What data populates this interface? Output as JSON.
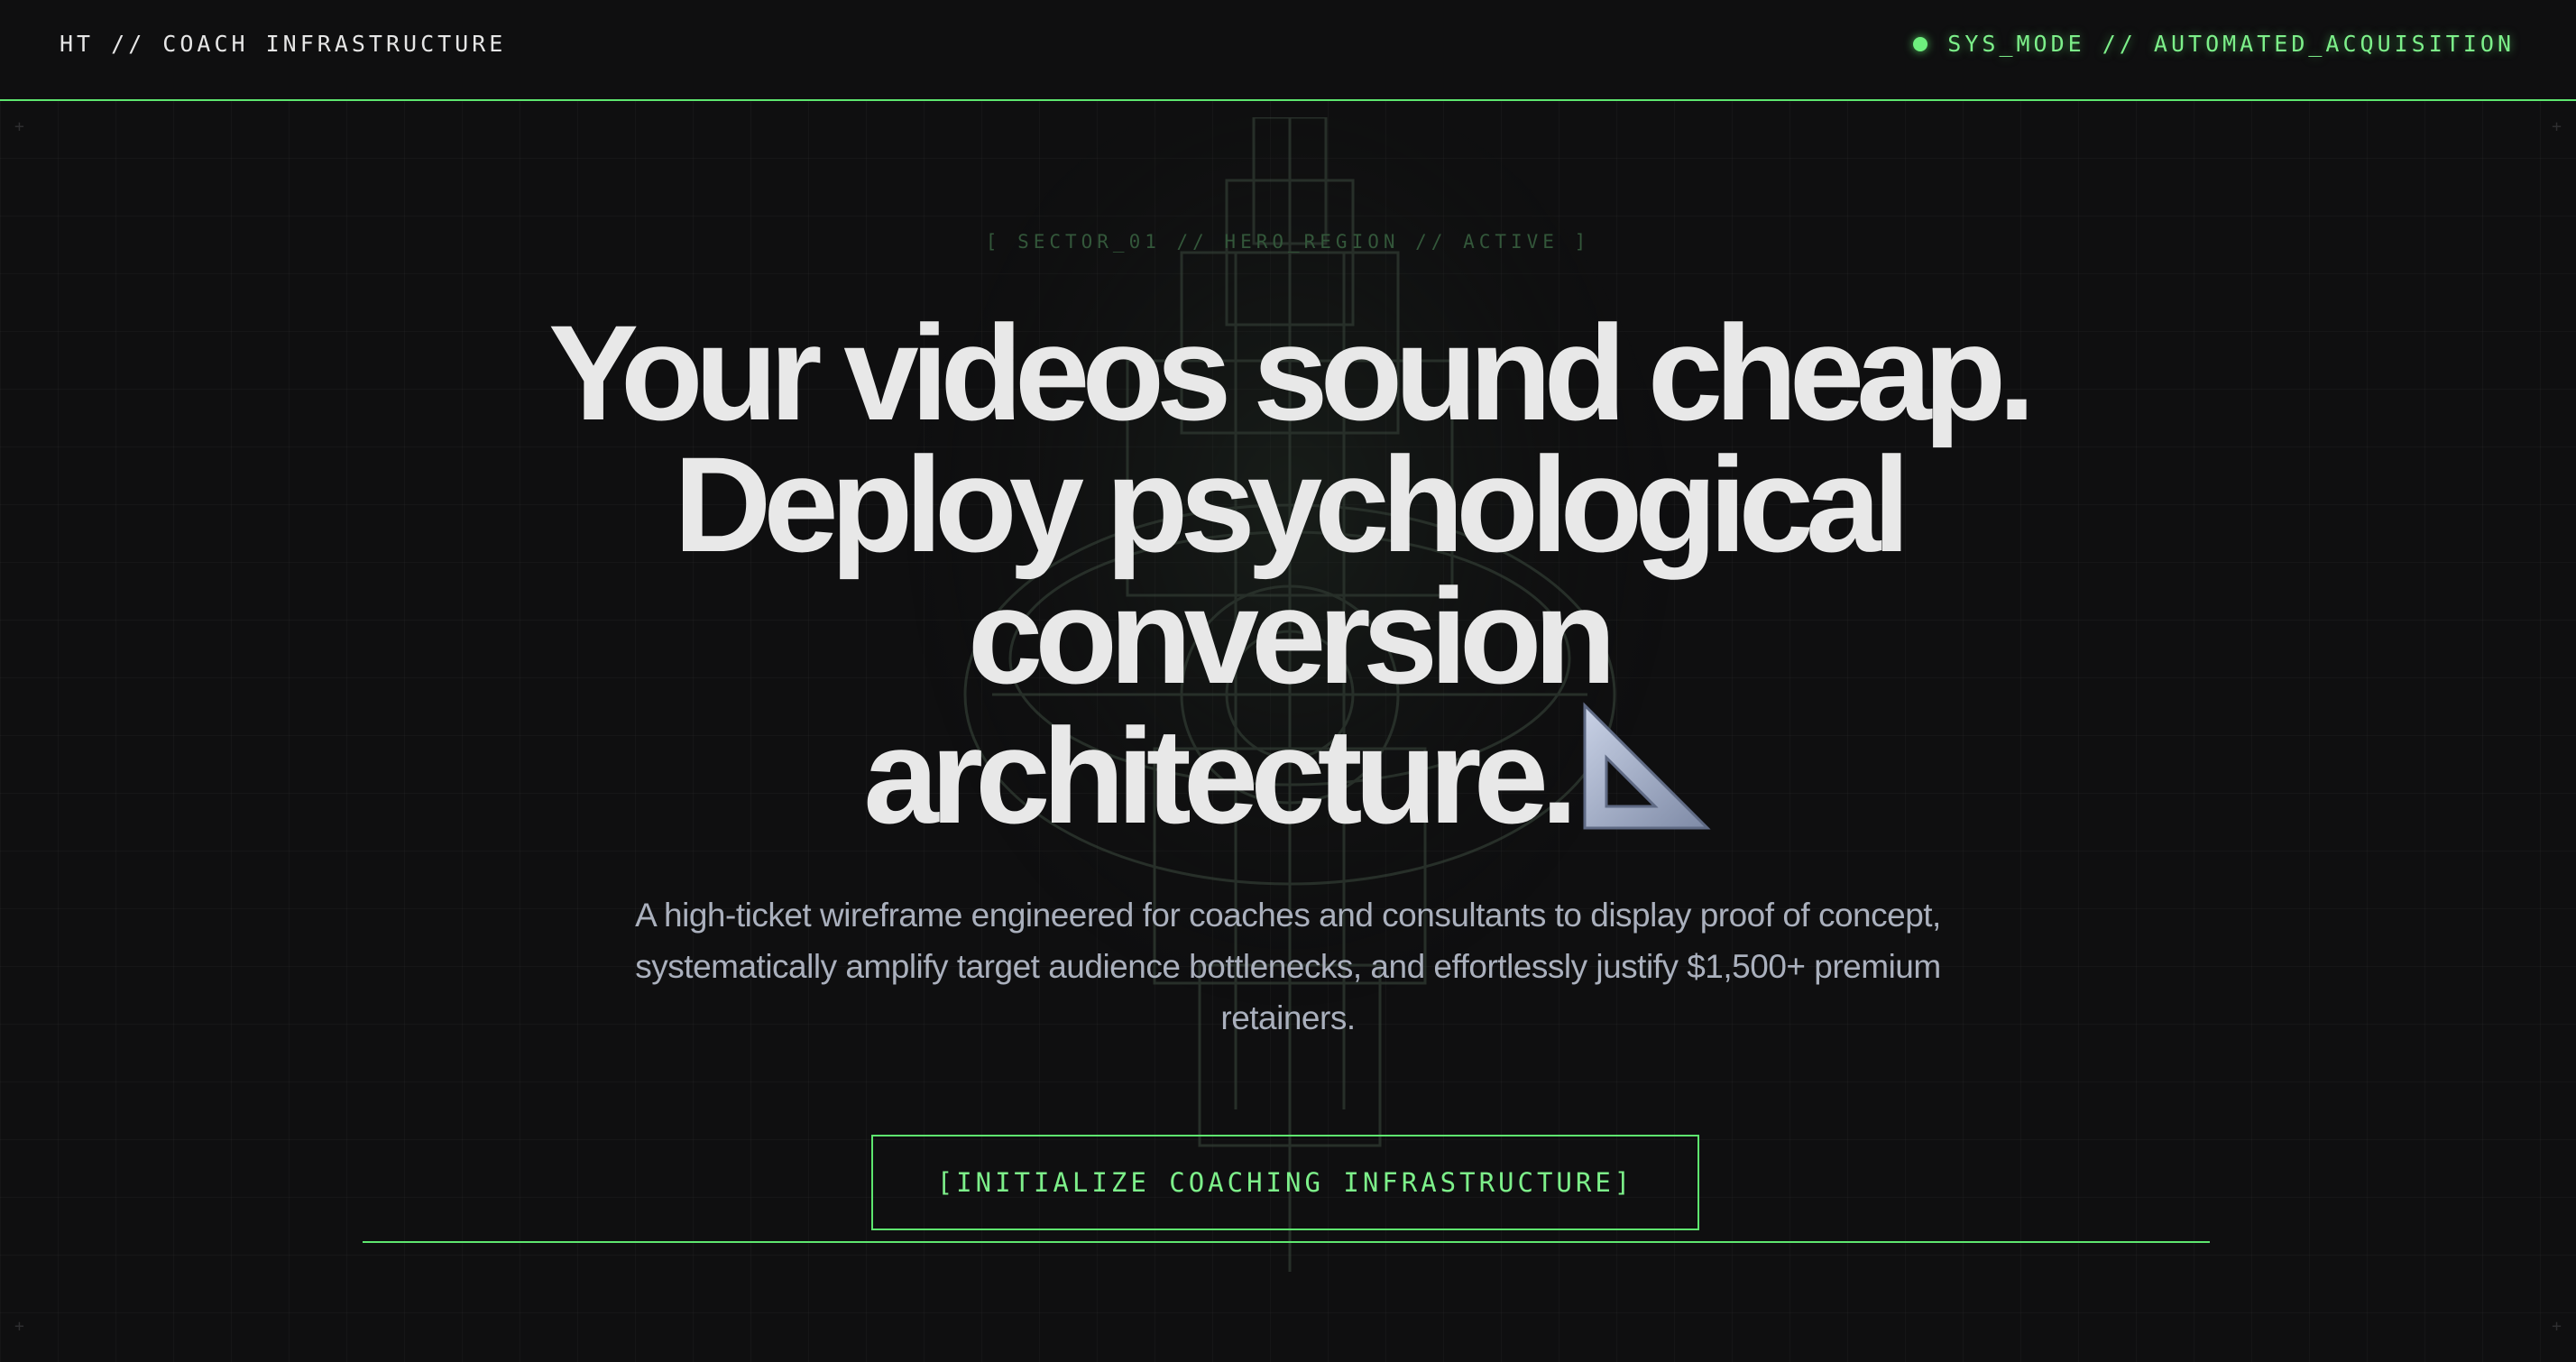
{
  "header": {
    "brand": "HT // COACH INFRASTRUCTURE",
    "status": "SYS_MODE // AUTOMATED_ACQUISITION"
  },
  "hero": {
    "sector_label": "[ SECTOR_01 // HERO_REGION // ACTIVE ]",
    "headline_lines": [
      "Your videos sound cheap.",
      "Deploy psychological",
      "conversion",
      "architecture."
    ],
    "subtext": "A high-ticket wireframe engineered for coaches and consultants to display proof of concept, systematically amplify target audience bottlenecks, and effortlessly justify $1,500+ premium retainers.",
    "cta_label": "[INITIALIZE COACHING INFRASTRUCTURE]"
  },
  "icons": {
    "status": "status-dot-icon",
    "headline_emoji": "triangular-ruler-icon",
    "corners": "plus-icon"
  },
  "colors": {
    "background": "#0f0f10",
    "accent_green": "#5ee66f",
    "headline": "#e8e8e8",
    "subtext": "#aab0bd"
  }
}
